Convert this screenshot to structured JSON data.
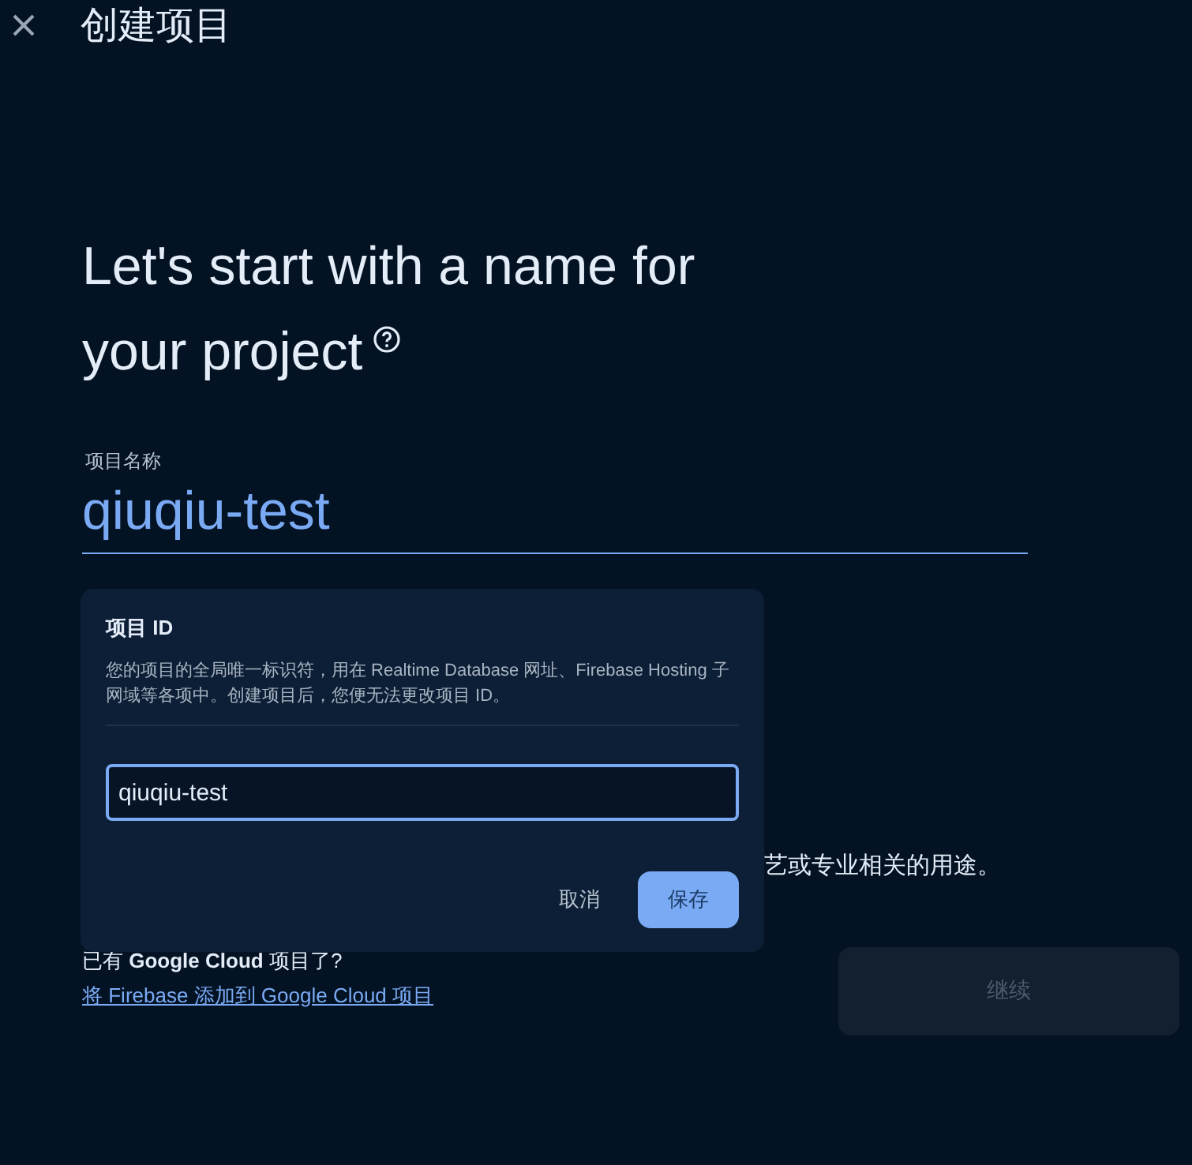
{
  "window": {
    "title": "创建项目"
  },
  "heading": [
    "Let's start with a name for",
    "your project"
  ],
  "name_field": {
    "label": "项目名称",
    "value": "qiuqiu-test"
  },
  "note_visible": "艺或专业相关的用途。",
  "gcp": {
    "text": "已有 **Google Cloud** 项目了?",
    "link": "将 Firebase 添加到 Google Cloud 项目"
  },
  "continue_button": {
    "label": "继续",
    "disabled": true
  },
  "id_popover": {
    "title": "项目 ID",
    "description": "您的项目的全局唯一标识符，用在 Realtime Database 网址、Firebase Hosting 子网域等各项中。创建项目后，您便无法更改项目 ID。",
    "value": "qiuqiu-test",
    "buttons": [
      {
        "kind": "text",
        "label": "取消"
      },
      {
        "kind": "filled",
        "label": "保存"
      }
    ]
  }
}
